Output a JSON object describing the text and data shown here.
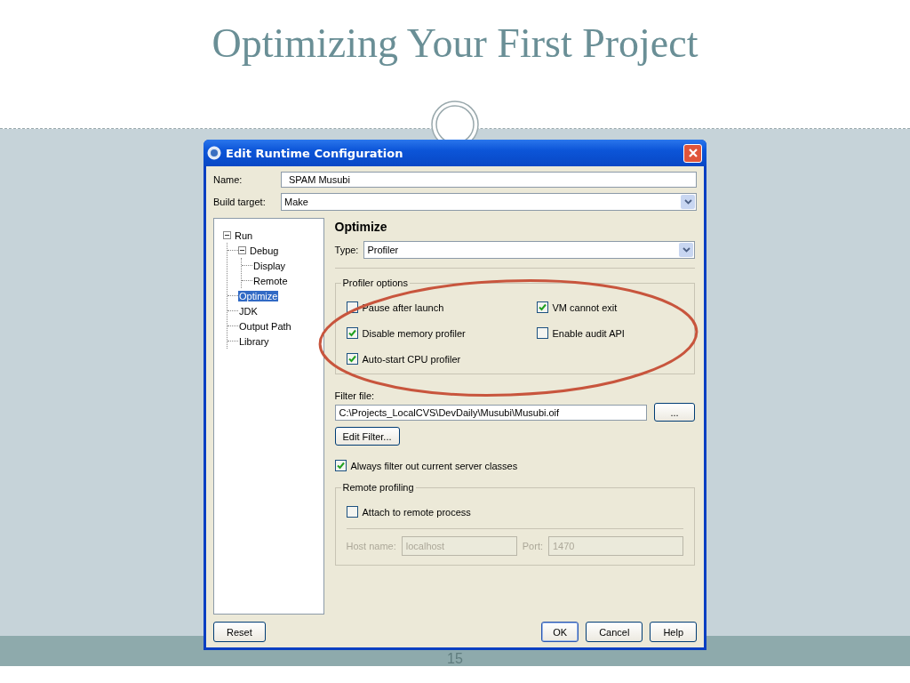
{
  "slide": {
    "title": "Optimizing Your First Project",
    "page_number": "15"
  },
  "dialog": {
    "title": "Edit Runtime Configuration",
    "name": {
      "label": "Name:",
      "value": "SPAM Musubi"
    },
    "build_target": {
      "label": "Build target:",
      "value": "Make"
    },
    "tree": [
      {
        "label": "Run",
        "expanded": true,
        "selected": false,
        "children": [
          {
            "label": "Debug",
            "expanded": true,
            "selected": false,
            "children": [
              {
                "label": "Display",
                "selected": false
              },
              {
                "label": "Remote",
                "selected": false
              }
            ]
          },
          {
            "label": "Optimize",
            "selected": true
          },
          {
            "label": "JDK",
            "selected": false
          },
          {
            "label": "Output Path",
            "selected": false
          },
          {
            "label": "Library",
            "selected": false
          }
        ]
      }
    ],
    "panel": {
      "heading": "Optimize",
      "type": {
        "label": "Type:",
        "value": "Profiler"
      },
      "profiler_options": {
        "legend": "Profiler options",
        "options": [
          {
            "label": "Pause after launch",
            "checked": false
          },
          {
            "label": "VM cannot exit",
            "checked": true
          },
          {
            "label": "Disable memory profiler",
            "checked": true
          },
          {
            "label": "Enable audit API",
            "checked": false
          },
          {
            "label": "Auto-start CPU profiler",
            "checked": true
          }
        ]
      },
      "filter_file": {
        "label": "Filter file:",
        "value": "C:\\Projects_LocalCVS\\DevDaily\\Musubi\\Musubi.oif",
        "browse_button": "..."
      },
      "edit_filter_button": "Edit Filter...",
      "always_filter": {
        "label": "Always filter out current server classes",
        "checked": true
      },
      "remote": {
        "legend": "Remote profiling",
        "attach": {
          "label": "Attach to remote process",
          "checked": false
        },
        "host": {
          "label": "Host name:",
          "value": "localhost",
          "disabled": true
        },
        "port": {
          "label": "Port:",
          "value": "1470",
          "disabled": true
        }
      }
    },
    "buttons_left": [
      "Reset"
    ],
    "buttons_right": [
      "OK",
      "Cancel",
      "Help"
    ]
  }
}
